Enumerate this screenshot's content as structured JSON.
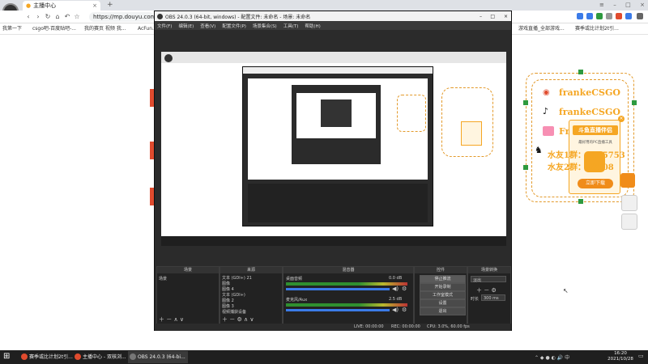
{
  "browser": {
    "tab_title": "主播中心",
    "new_tab": "+",
    "url": "https://mp.douyu.com/liv",
    "bookmarks": [
      "应用",
      "我第一下",
      "csgo吧-百度贴吧-...",
      "我的赛页 视频 我...",
      "AcFun..."
    ],
    "bookmarks_right": [
      "游戏直播_全部游戏...",
      "赛季或比计划2t引..."
    ]
  },
  "promo": {
    "line1": "frankeCSGO",
    "line2": "frankeCSGO",
    "line3": "Fr",
    "badge": "斗鱼直播伴侣",
    "desc": "最好用的PC直播工具",
    "qq1": "水友1群：",
    "qq1_num": "1185753",
    "qq2": "水友2群：",
    "qq2_num": "78108",
    "download": "立即下载"
  },
  "obs": {
    "title": "OBS 24.0.3 (64-bit, windows) - 配置文件: 未命名 - 场景: 未命名",
    "menu": [
      "文件(F)",
      "编辑(E)",
      "查看(V)",
      "配置文件(P)",
      "场景集合(S)",
      "工具(T)",
      "帮助(H)"
    ],
    "docks": {
      "scenes": {
        "header": "场景",
        "item": "场景"
      },
      "sources": {
        "header": "来源",
        "items": [
          "文本 (GDI+) 21",
          "图像",
          "图像 4",
          "文本 (GDI+)",
          "图像 2",
          "图像 3",
          "视频捕获设备"
        ]
      },
      "mixer": {
        "header": "混音器",
        "ch1": "桌面音频",
        "ch1_db": "0.0 dB",
        "ch2": "麦克风/Aux",
        "ch2_db": "2.5 dB"
      },
      "controls": {
        "header": "控件",
        "buttons": [
          "停止推流",
          "开始录制",
          "工作室模式",
          "设置",
          "退出"
        ]
      },
      "transitions": {
        "header": "场景转换",
        "type": "淡出",
        "duration_label": "时长",
        "duration": "300 ms"
      }
    },
    "status": {
      "live": "LIVE: 00:00:00",
      "rec": "REC: 00:00:00",
      "cpu": "CPU: 3.0%, 60.00 fps"
    }
  },
  "taskbar": {
    "items": [
      "赛季或比计划2t引...",
      "主播中心 - 双核浏...",
      "OBS 24.0.3 (64-bi..."
    ],
    "time": "16:20",
    "date": "2021/10/28"
  },
  "colors": {
    "accent": "#f5a623",
    "obs_bg": "#2b2b2b",
    "dash": "#e39a2b",
    "green": "#2e9a3f"
  }
}
